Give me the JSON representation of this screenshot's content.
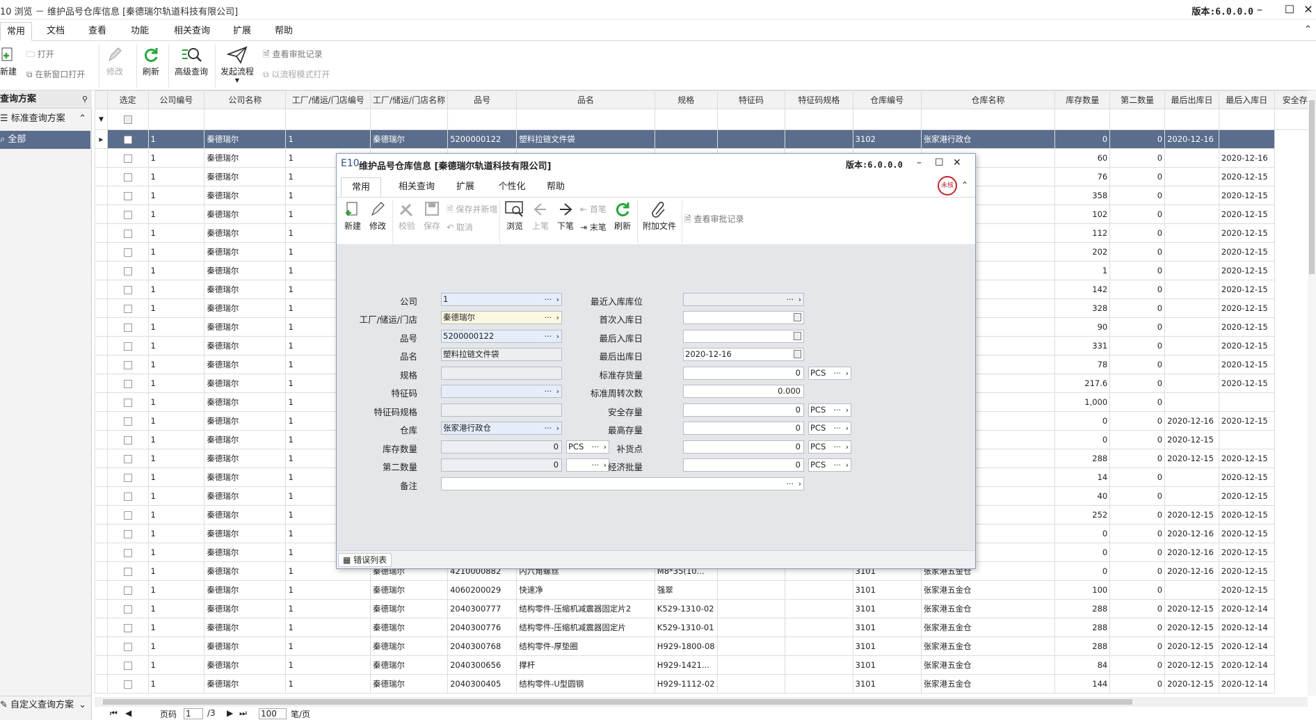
{
  "window": {
    "title": "10  浏览 － 维护品号仓库信息 [秦德瑞尔轨道科技有限公司]",
    "version": "版本:6.0.0.0"
  },
  "menu": {
    "tabs": [
      "常用",
      "文档",
      "查看",
      "功能",
      "相关查询",
      "扩展",
      "帮助"
    ]
  },
  "ribbon": {
    "new": "新建",
    "open": "打开",
    "open_new_window": "在新窗口打开",
    "edit": "修改",
    "refresh": "刷新",
    "advanced_query": "高级查询",
    "start_flow": "发起流程",
    "view_approval": "查看审批记录",
    "open_flow_mode": "以流程模式打开"
  },
  "left_panel": {
    "header": "查询方案",
    "standard": "标准查询方案",
    "all": "全部",
    "custom": "自定义查询方案"
  },
  "grid": {
    "columns": [
      "选定",
      "公司编号",
      "公司名称",
      "工厂/储运/门店编号",
      "工厂/储运/门店名称",
      "品号",
      "品名",
      "规格",
      "特征码",
      "特征码规格",
      "仓库编号",
      "仓库名称",
      "库存数量",
      "第二数量",
      "最后出库日",
      "最后入库日",
      "安全存"
    ],
    "rows": [
      [
        "",
        "1",
        "秦德瑞尔",
        "1",
        "秦德瑞尔",
        "5200000122",
        "塑料拉链文件袋",
        "",
        "",
        "",
        "3102",
        "张家港行政仓",
        "0",
        "0",
        "2020-12-16",
        ""
      ],
      [
        "",
        "1",
        "秦德瑞尔",
        "1",
        "",
        "",
        "",
        "",
        "",
        "",
        "",
        "",
        "60",
        "0",
        "",
        "2020-12-16"
      ],
      [
        "",
        "1",
        "秦德瑞尔",
        "1",
        "",
        "",
        "",
        "",
        "",
        "",
        "",
        "",
        "76",
        "0",
        "",
        "2020-12-15"
      ],
      [
        "",
        "1",
        "秦德瑞尔",
        "1",
        "",
        "",
        "",
        "",
        "",
        "",
        "",
        "",
        "358",
        "0",
        "",
        "2020-12-15"
      ],
      [
        "",
        "1",
        "秦德瑞尔",
        "1",
        "",
        "",
        "",
        "",
        "",
        "",
        "",
        "",
        "102",
        "0",
        "",
        "2020-12-15"
      ],
      [
        "",
        "1",
        "秦德瑞尔",
        "1",
        "",
        "",
        "",
        "",
        "",
        "",
        "",
        "",
        "112",
        "0",
        "",
        "2020-12-15"
      ],
      [
        "",
        "1",
        "秦德瑞尔",
        "1",
        "",
        "",
        "",
        "",
        "",
        "",
        "",
        "",
        "202",
        "0",
        "",
        "2020-12-15"
      ],
      [
        "",
        "1",
        "秦德瑞尔",
        "1",
        "",
        "",
        "",
        "",
        "",
        "",
        "",
        "",
        "1",
        "0",
        "",
        "2020-12-15"
      ],
      [
        "",
        "1",
        "秦德瑞尔",
        "1",
        "",
        "",
        "",
        "",
        "",
        "",
        "",
        "",
        "142",
        "0",
        "",
        "2020-12-15"
      ],
      [
        "",
        "1",
        "秦德瑞尔",
        "1",
        "",
        "",
        "",
        "",
        "",
        "",
        "",
        "",
        "328",
        "0",
        "",
        "2020-12-15"
      ],
      [
        "",
        "1",
        "秦德瑞尔",
        "1",
        "",
        "",
        "",
        "",
        "",
        "",
        "",
        "",
        "90",
        "0",
        "",
        "2020-12-15"
      ],
      [
        "",
        "1",
        "秦德瑞尔",
        "1",
        "",
        "",
        "",
        "",
        "",
        "",
        "",
        "",
        "331",
        "0",
        "",
        "2020-12-15"
      ],
      [
        "",
        "1",
        "秦德瑞尔",
        "1",
        "",
        "",
        "",
        "",
        "",
        "",
        "",
        "",
        "78",
        "0",
        "",
        "2020-12-15"
      ],
      [
        "",
        "1",
        "秦德瑞尔",
        "1",
        "",
        "",
        "",
        "",
        "",
        "",
        "",
        "",
        "217.6",
        "0",
        "",
        "2020-12-15"
      ],
      [
        "",
        "1",
        "秦德瑞尔",
        "1",
        "",
        "",
        "",
        "",
        "",
        "",
        "",
        "",
        "1,000",
        "0",
        "",
        ""
      ],
      [
        "",
        "1",
        "秦德瑞尔",
        "1",
        "",
        "",
        "",
        "",
        "",
        "",
        "",
        "",
        "0",
        "0",
        "2020-12-16",
        "2020-12-15"
      ],
      [
        "",
        "1",
        "秦德瑞尔",
        "1",
        "",
        "",
        "",
        "",
        "",
        "",
        "",
        "",
        "0",
        "0",
        "2020-12-15",
        ""
      ],
      [
        "",
        "1",
        "秦德瑞尔",
        "1",
        "",
        "",
        "",
        "",
        "",
        "",
        "",
        "",
        "288",
        "0",
        "2020-12-15",
        "2020-12-15"
      ],
      [
        "",
        "1",
        "秦德瑞尔",
        "1",
        "",
        "",
        "",
        "",
        "",
        "",
        "",
        "",
        "14",
        "0",
        "",
        "2020-12-15"
      ],
      [
        "",
        "1",
        "秦德瑞尔",
        "1",
        "",
        "",
        "",
        "",
        "",
        "",
        "",
        "",
        "40",
        "0",
        "",
        "2020-12-15"
      ],
      [
        "",
        "1",
        "秦德瑞尔",
        "1",
        "",
        "",
        "",
        "",
        "",
        "",
        "",
        "",
        "252",
        "0",
        "2020-12-15",
        "2020-12-15"
      ],
      [
        "",
        "1",
        "秦德瑞尔",
        "1",
        "",
        "",
        "",
        "",
        "",
        "",
        "",
        "",
        "0",
        "0",
        "2020-12-16",
        "2020-12-15"
      ],
      [
        "",
        "1",
        "秦德瑞尔",
        "1",
        "",
        "",
        "",
        "",
        "",
        "",
        "",
        "",
        "0",
        "0",
        "2020-12-16",
        "2020-12-15"
      ],
      [
        "",
        "1",
        "秦德瑞尔",
        "1",
        "秦德瑞尔",
        "4210000882",
        "内六角螺丝",
        "M8*35(10...",
        "",
        "",
        "3101",
        "张家港五金仓",
        "0",
        "0",
        "2020-12-16",
        "2020-12-15"
      ],
      [
        "",
        "1",
        "秦德瑞尔",
        "1",
        "秦德瑞尔",
        "4060200029",
        "快速净",
        "强翠",
        "",
        "",
        "3101",
        "张家港五金仓",
        "100",
        "0",
        "",
        "2020-12-15"
      ],
      [
        "",
        "1",
        "秦德瑞尔",
        "1",
        "秦德瑞尔",
        "2040300777",
        "结构零件-压缩机减震器固定片2",
        "K529-1310-02",
        "",
        "",
        "3101",
        "张家港五金仓",
        "288",
        "0",
        "2020-12-15",
        "2020-12-14"
      ],
      [
        "",
        "1",
        "秦德瑞尔",
        "1",
        "秦德瑞尔",
        "2040300776",
        "结构零件-压缩机减震器固定片",
        "K529-1310-01",
        "",
        "",
        "3101",
        "张家港五金仓",
        "288",
        "0",
        "2020-12-15",
        "2020-12-14"
      ],
      [
        "",
        "1",
        "秦德瑞尔",
        "1",
        "秦德瑞尔",
        "2040300768",
        "结构零件-厚垫圈",
        "H929-1800-08",
        "",
        "",
        "3101",
        "张家港五金仓",
        "288",
        "0",
        "2020-12-15",
        "2020-12-14"
      ],
      [
        "",
        "1",
        "秦德瑞尔",
        "1",
        "秦德瑞尔",
        "2040300656",
        "撑杆",
        "H929-1421...",
        "",
        "",
        "3101",
        "张家港五金仓",
        "84",
        "0",
        "2020-12-15",
        "2020-12-14"
      ],
      [
        "",
        "1",
        "秦德瑞尔",
        "1",
        "秦德瑞尔",
        "2040300405",
        "结构零件-U型圆钢",
        "H929-1112-02",
        "",
        "",
        "3101",
        "张家港五金仓",
        "144",
        "0",
        "2020-12-15",
        "2020-12-14"
      ]
    ]
  },
  "pager": {
    "page_label": "页码",
    "page": "1",
    "total": "/3",
    "page_size": "100",
    "size_label": "笔/页"
  },
  "dialog": {
    "logo": "E10",
    "title": "维护品号仓库信息 [秦德瑞尔轨道科技有限公司]",
    "version": "版本:6.0.0.0",
    "tabs": [
      "常用",
      "相关查询",
      "扩展",
      "个性化",
      "帮助"
    ],
    "toolbar": {
      "new": "新建",
      "edit": "修改",
      "verify": "校验",
      "save": "保存",
      "save_new": "保存并新增",
      "cancel": "取消",
      "browse": "浏览",
      "prev": "上笔",
      "next": "下笔",
      "first": "首笔",
      "last": "末笔",
      "refresh": "刷新",
      "attach": "附加文件",
      "view_approval": "查看审批记录"
    },
    "stamp": "未核",
    "fields": {
      "company": {
        "label": "公司",
        "value": "1"
      },
      "plant": {
        "label": "工厂/储运/门店",
        "value": "秦德瑞尔"
      },
      "item_no": {
        "label": "品号",
        "value": "5200000122"
      },
      "item_name": {
        "label": "品名",
        "value": "塑料拉链文件袋"
      },
      "spec": {
        "label": "规格",
        "value": ""
      },
      "feature_code": {
        "label": "特征码",
        "value": ""
      },
      "feature_spec": {
        "label": "特征码规格",
        "value": ""
      },
      "warehouse": {
        "label": "仓库",
        "value": "张家港行政仓"
      },
      "stock_qty": {
        "label": "库存数量",
        "value": "0",
        "unit": "PCS"
      },
      "second_qty": {
        "label": "第二数量",
        "value": "0"
      },
      "remark": {
        "label": "备注",
        "value": ""
      },
      "recent_bin": {
        "label": "最近入库库位",
        "value": ""
      },
      "first_in": {
        "label": "首次入库日",
        "value": ""
      },
      "last_in": {
        "label": "最后入库日",
        "value": ""
      },
      "last_out": {
        "label": "最后出库日",
        "value": "2020-12-16"
      },
      "std_stock": {
        "label": "标准存货量",
        "value": "0",
        "unit": "PCS"
      },
      "std_turnover": {
        "label": "标准周转次数",
        "value": "0.000"
      },
      "safety_stock": {
        "label": "安全存量",
        "value": "0",
        "unit": "PCS"
      },
      "max_stock": {
        "label": "最高存量",
        "value": "0",
        "unit": "PCS"
      },
      "reorder": {
        "label": "补货点",
        "value": "0",
        "unit": "PCS"
      },
      "eoq": {
        "label": "经济批量",
        "value": "0",
        "unit": "PCS"
      }
    },
    "footer": "错误列表"
  }
}
